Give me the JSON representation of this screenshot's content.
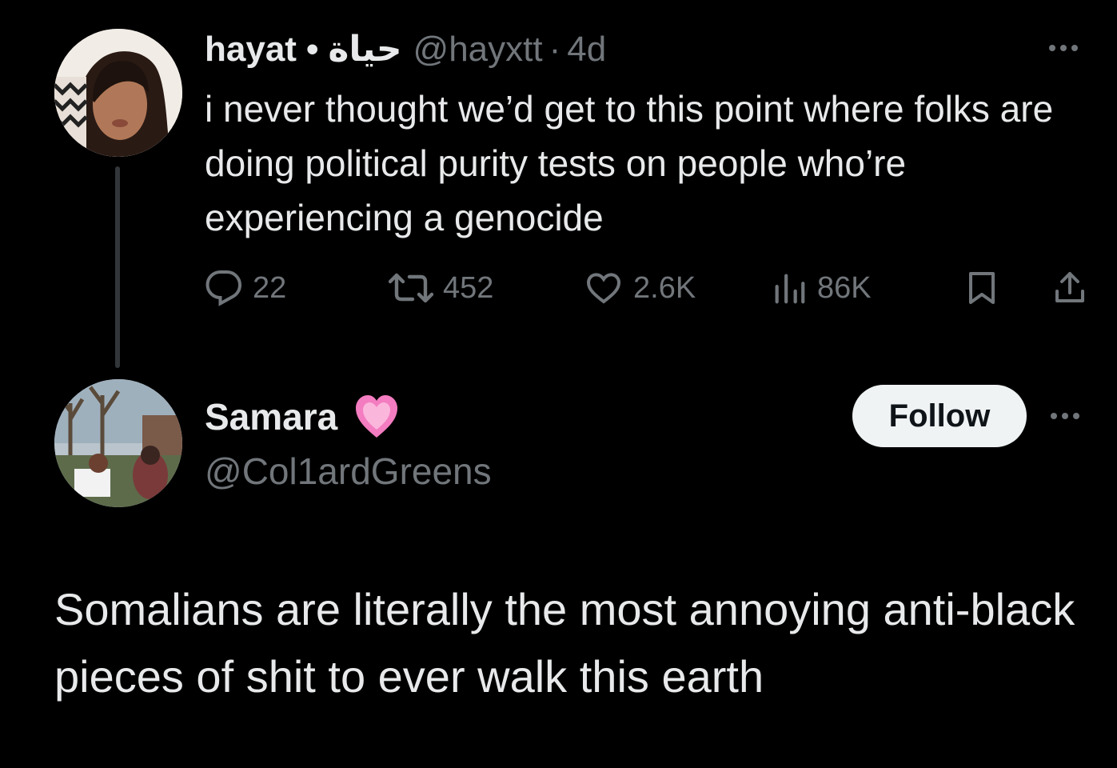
{
  "tweet1": {
    "name": "hayat",
    "separator": "•",
    "name_arabic": "حياة",
    "handle": "@hayxtt",
    "time_separator": "·",
    "time": "4d",
    "text": "i never thought we’d get to this point where folks are doing political purity tests on people who’re experiencing a genocide",
    "actions": {
      "replies": "22",
      "reposts": "452",
      "likes": "2.6K",
      "views": "86K"
    }
  },
  "tweet2": {
    "name": "Samara",
    "handle": "@Col1ardGreens",
    "follow_label": "Follow",
    "text": "Somalians are literally the most annoying anti-black pieces of shit to ever walk this earth"
  },
  "colors": {
    "background": "#000000",
    "text": "#e7e9ea",
    "muted": "#71767b",
    "follow_bg": "#eff3f4",
    "heart": "#f47cc0"
  },
  "icons": [
    "reply-icon",
    "repost-icon",
    "like-icon",
    "views-icon",
    "bookmark-icon",
    "share-icon",
    "pink-heart-icon",
    "more-icon"
  ]
}
